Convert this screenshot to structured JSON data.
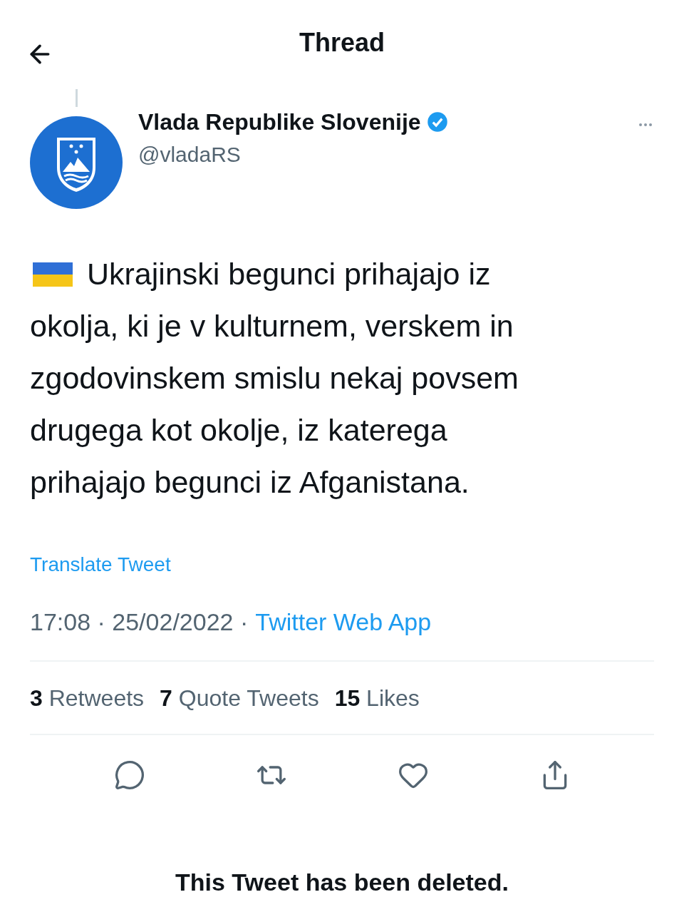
{
  "header": {
    "title": "Thread"
  },
  "author": {
    "name": "Vlada Republike Slovenije",
    "verified": true,
    "handle": "@vladaRS"
  },
  "tweet": {
    "lines": [
      "Ukrajinski begunci prihajajo iz",
      "okolja, ki je v kulturnem, verskem in",
      "zgodovinskem smislu nekaj povsem",
      "drugega kot okolje, iz katerega",
      "prihajajo begunci iz Afganistana."
    ],
    "translate": "Translate Tweet",
    "timestamp": "17:08 · 25/02/2022 ·",
    "source": "Twitter Web App"
  },
  "stats": [
    {
      "count": "3",
      "label": "Retweets"
    },
    {
      "count": "7",
      "label": "Quote Tweets"
    },
    {
      "count": "15",
      "label": "Likes"
    }
  ],
  "actions": [
    {
      "kind": "reply"
    },
    {
      "kind": "retweet"
    },
    {
      "kind": "like"
    },
    {
      "kind": "share"
    }
  ],
  "notice": "This Tweet has been deleted."
}
